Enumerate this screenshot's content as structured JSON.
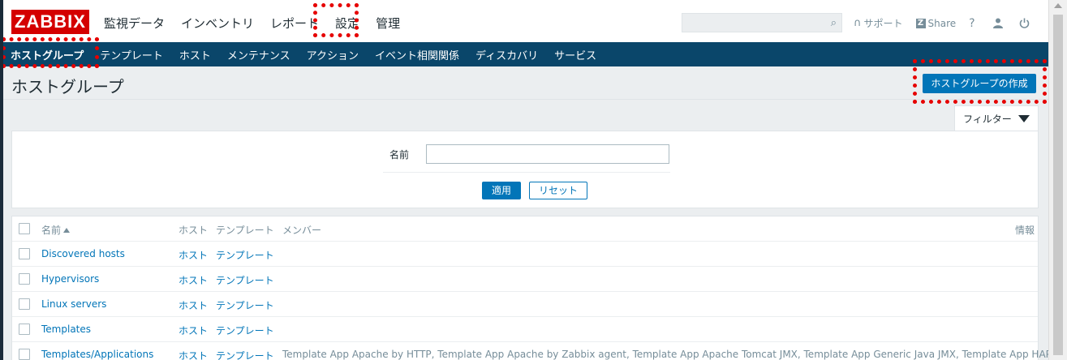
{
  "header": {
    "logo": "ZABBIX",
    "menu": [
      "監視データ",
      "インベントリ",
      "レポート",
      "設定",
      "管理"
    ],
    "active_menu": "設定",
    "search_placeholder": "",
    "links": {
      "support": "サポート",
      "share": "Share",
      "help": "?"
    }
  },
  "subnav": {
    "items": [
      "ホストグループ",
      "テンプレート",
      "ホスト",
      "メンテナンス",
      "アクション",
      "イベント相関関係",
      "ディスカバリ",
      "サービス"
    ],
    "active": "ホストグループ"
  },
  "page": {
    "title": "ホストグループ",
    "create_button": "ホストグループの作成"
  },
  "filter": {
    "tab_label": "フィルター",
    "name_label": "名前",
    "name_value": "",
    "apply": "適用",
    "reset": "リセット"
  },
  "table": {
    "headers": {
      "name": "名前",
      "hosts": "ホスト",
      "templates": "テンプレート",
      "members": "メンバー",
      "info": "情報"
    },
    "rows": [
      {
        "name": "Discovered hosts",
        "hosts": "ホスト",
        "templates": "テンプレート",
        "members": ""
      },
      {
        "name": "Hypervisors",
        "hosts": "ホスト",
        "templates": "テンプレート",
        "members": ""
      },
      {
        "name": "Linux servers",
        "hosts": "ホスト",
        "templates": "テンプレート",
        "members": ""
      },
      {
        "name": "Templates",
        "hosts": "ホスト",
        "templates": "テンプレート",
        "members": ""
      },
      {
        "name": "Templates/Applications",
        "hosts": "ホスト",
        "templates": "テンプレート",
        "members": "Template App Apache by HTTP, Template App Apache by Zabbix agent, Template App Apache Tomcat JMX, Template App Generic Java JMX, Template App HAProxy"
      }
    ]
  },
  "colors": {
    "brand": "#d40000",
    "subnav": "#0a466a",
    "accent": "#0275b8",
    "annotation": "#e60000"
  }
}
